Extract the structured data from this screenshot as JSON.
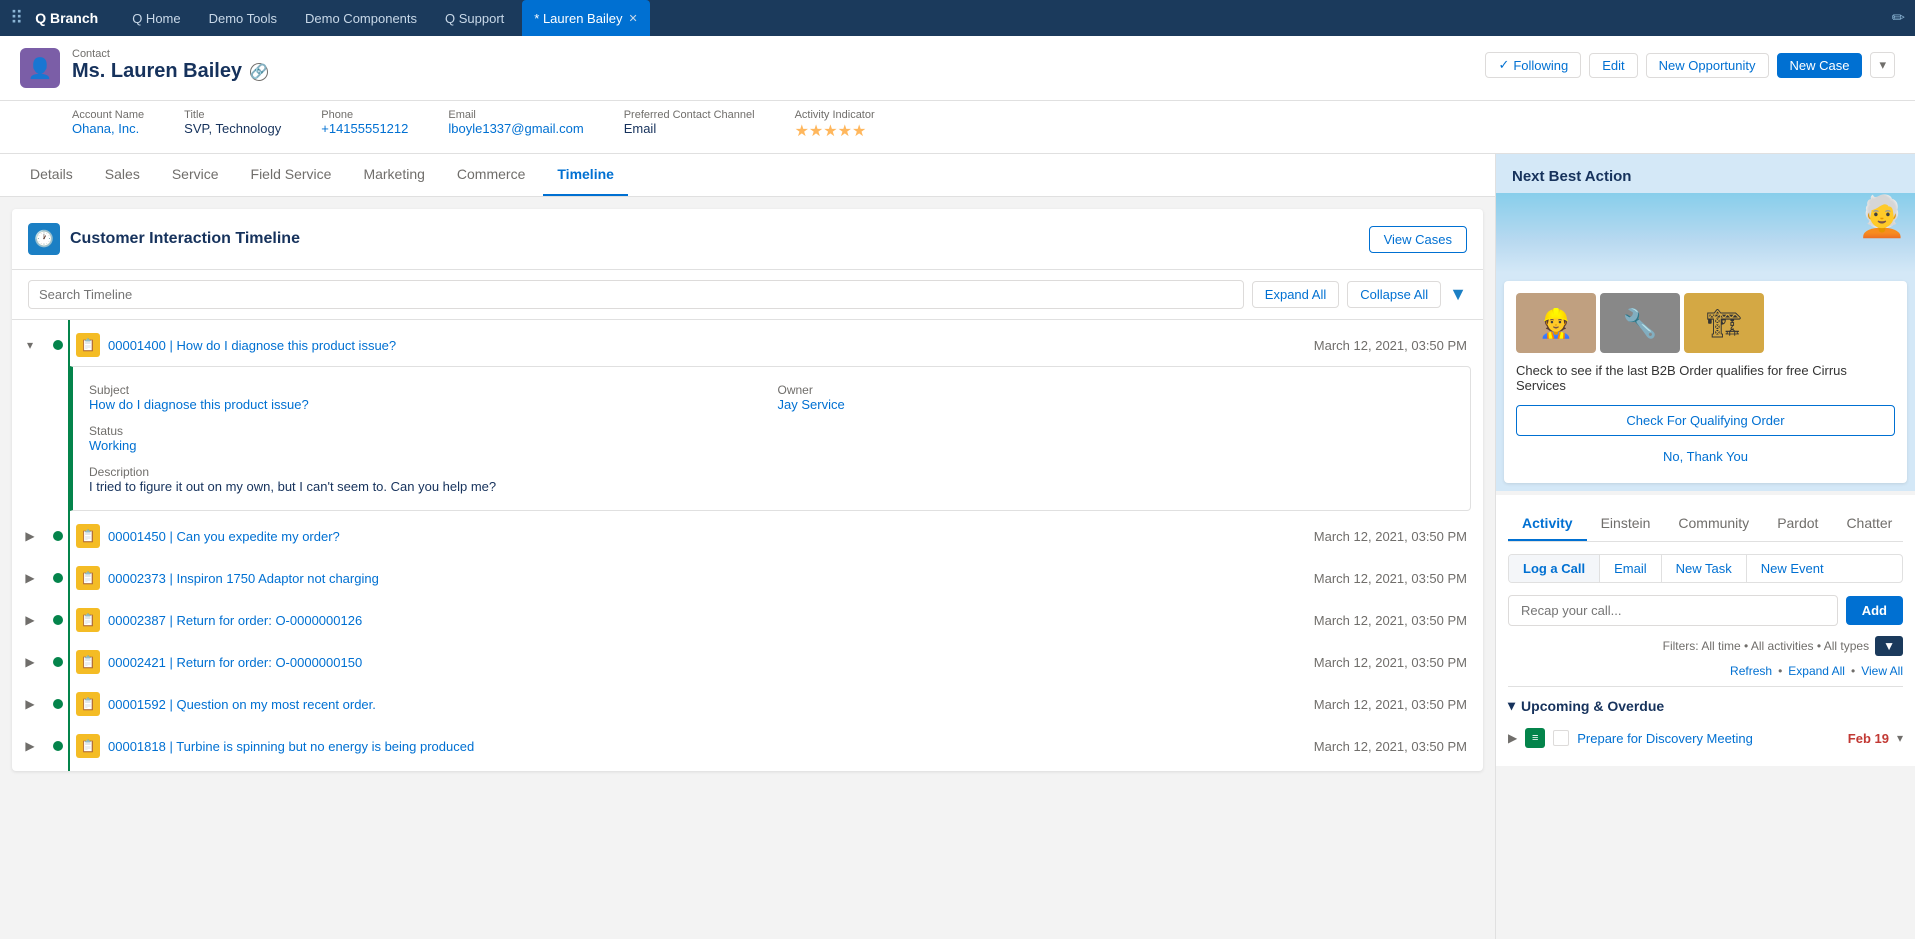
{
  "nav": {
    "brand": "Q Branch",
    "links": [
      "Q Home",
      "Demo Tools",
      "Demo Components",
      "Q Support"
    ],
    "active_tab": "* Lauren Bailey",
    "edit_icon": "✏"
  },
  "record": {
    "type": "Contact",
    "name": "Ms. Lauren Bailey",
    "following_label": "Following",
    "edit_label": "Edit",
    "new_opportunity_label": "New Opportunity",
    "new_case_label": "New Case",
    "fields": {
      "account_name_label": "Account Name",
      "account_name": "Ohana, Inc.",
      "title_label": "Title",
      "title": "SVP, Technology",
      "phone_label": "Phone",
      "phone": "+14155551212",
      "email_label": "Email",
      "email": "lboyle1337@gmail.com",
      "preferred_contact_label": "Preferred Contact Channel",
      "preferred_contact": "Email",
      "activity_indicator_label": "Activity Indicator",
      "stars": "★★★★★"
    }
  },
  "tabs": [
    "Details",
    "Sales",
    "Service",
    "Field Service",
    "Marketing",
    "Commerce",
    "Timeline"
  ],
  "active_tab_index": 6,
  "timeline": {
    "title": "Customer Interaction Timeline",
    "view_cases_label": "View Cases",
    "search_placeholder": "Search Timeline",
    "expand_all_label": "Expand All",
    "collapse_all_label": "Collapse All",
    "items": [
      {
        "id": "00001400",
        "subject": "How do I diagnose this product issue?",
        "date": "March 12, 2021, 03:50 PM",
        "expanded": true,
        "detail": {
          "subject_label": "Subject",
          "subject": "How do I diagnose this product issue?",
          "owner_label": "Owner",
          "owner": "Jay Service",
          "status_label": "Status",
          "status": "Working",
          "description_label": "Description",
          "description": "I tried to figure it out on my own, but I can't seem to. Can you help me?"
        }
      },
      {
        "id": "00001450",
        "subject": "Can you expedite my order?",
        "date": "March 12, 2021, 03:50 PM",
        "expanded": false
      },
      {
        "id": "00002373",
        "subject": "Inspiron 1750 Adaptor not charging",
        "date": "March 12, 2021, 03:50 PM",
        "expanded": false
      },
      {
        "id": "00002387",
        "subject": "Return for order: O-0000000126",
        "date": "March 12, 2021, 03:50 PM",
        "expanded": false
      },
      {
        "id": "00002421",
        "subject": "Return for order: O-0000000150",
        "date": "March 12, 2021, 03:50 PM",
        "expanded": false
      },
      {
        "id": "00001592",
        "subject": "Question on my most recent order.",
        "date": "March 12, 2021, 03:50 PM",
        "expanded": false
      },
      {
        "id": "00001818",
        "subject": "Turbine is spinning but no energy is being produced",
        "date": "March 12, 2021, 03:50 PM",
        "expanded": false
      }
    ]
  },
  "nba": {
    "title": "Next Best Action",
    "description": "Check to see if the last B2B Order qualifies for free Cirrus Services",
    "check_order_label": "Check For Qualifying Order",
    "no_thanks_label": "No, Thank You"
  },
  "activity": {
    "tabs": [
      "Activity",
      "Einstein",
      "Community",
      "Pardot",
      "Chatter"
    ],
    "active_tab": "Activity",
    "sub_tabs": [
      "Log a Call",
      "Email",
      "New Task",
      "New Event"
    ],
    "active_sub_tab": "Log a Call",
    "input_placeholder": "Recap your call...",
    "add_label": "Add",
    "filter_text": "Filters: All time • All activities • All types",
    "refresh_label": "Refresh",
    "expand_all_label": "Expand All",
    "view_all_label": "View All",
    "upcoming_label": "Upcoming & Overdue",
    "upcoming_items": [
      {
        "label": "Prepare for Discovery Meeting",
        "date": "Feb 19"
      }
    ]
  }
}
